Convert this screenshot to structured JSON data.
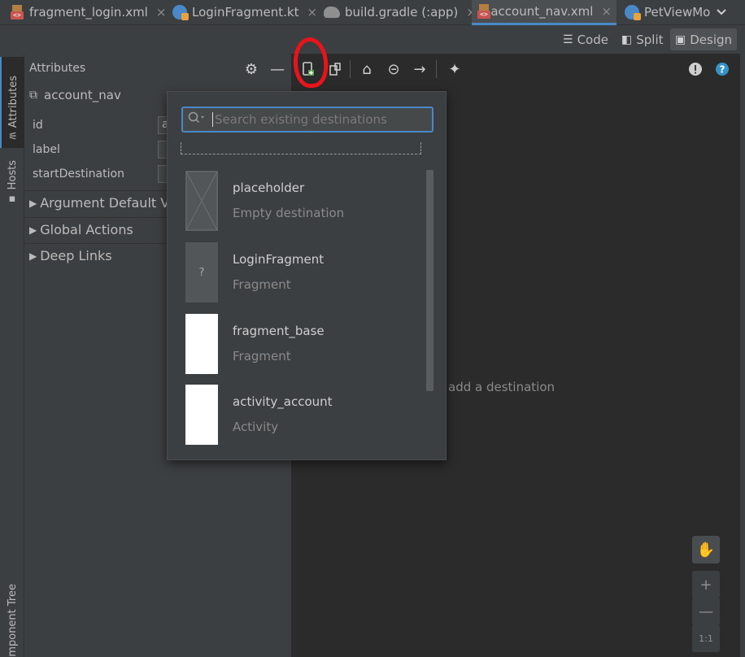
{
  "tabs": [
    {
      "label": "fragment_login.xml",
      "icon": "xml-layout-icon"
    },
    {
      "label": "LoginFragment.kt",
      "icon": "kotlin-file-icon"
    },
    {
      "label": "build.gradle (:app)",
      "icon": "gradle-icon"
    },
    {
      "label": "account_nav.xml",
      "icon": "xml-layout-icon",
      "active": true
    },
    {
      "label": "PetViewMo",
      "icon": "kotlin-file-icon"
    }
  ],
  "view_modes": {
    "code": "Code",
    "split": "Split",
    "design": "Design",
    "selected": "Design"
  },
  "left_strip": {
    "attributes": "Attributes",
    "hosts": "Hosts",
    "component_tree": "mponent Tree"
  },
  "attributes": {
    "header": "Attributes",
    "graph_name": "account_nav",
    "fields": [
      {
        "label": "id",
        "value": "accou"
      },
      {
        "label": "label",
        "value": ""
      },
      {
        "label": "startDestination",
        "value": ""
      }
    ],
    "sections": [
      "Argument Default Va",
      "Global Actions",
      "Deep Links"
    ]
  },
  "popup": {
    "search_placeholder": "Search existing destinations",
    "destinations": [
      {
        "name": "placeholder",
        "type": "Empty destination",
        "thumb": "placeholder"
      },
      {
        "name": "LoginFragment",
        "type": "Fragment",
        "thumb": "question",
        "thumb_text": "?"
      },
      {
        "name": "fragment_base",
        "type": "Fragment",
        "thumb": "white"
      },
      {
        "name": "activity_account",
        "type": "Activity",
        "thumb": "white"
      }
    ]
  },
  "canvas": {
    "hint": "add a destination"
  },
  "zoom_tools": {
    "plus": "+",
    "minus": "—",
    "one_to_one": "1:1"
  },
  "colors": {
    "accent": "#4a88c7",
    "highlight": "#e8141b",
    "background": "#2b2b2b",
    "panel": "#3c3f41"
  }
}
